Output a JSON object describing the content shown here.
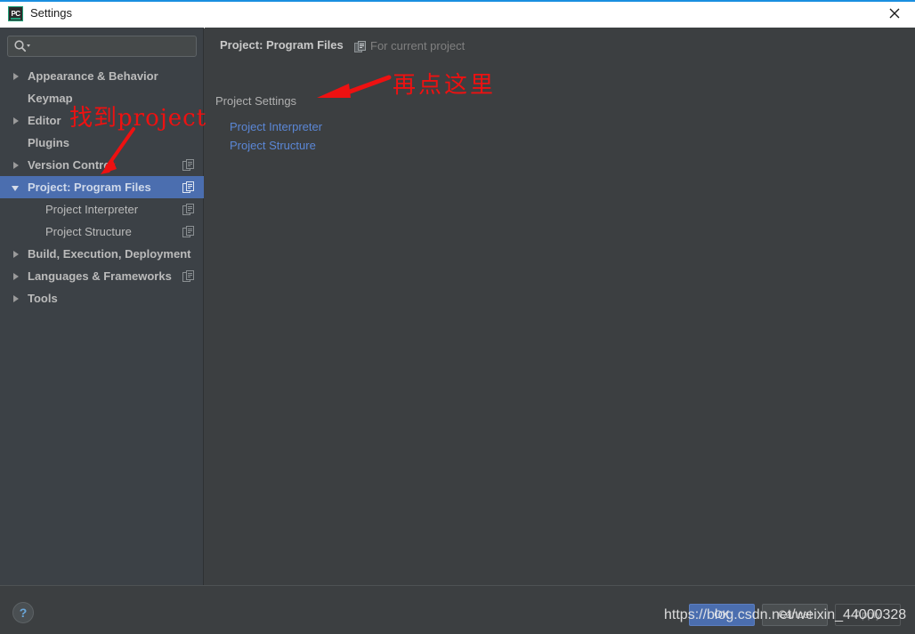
{
  "window": {
    "title": "Settings",
    "app_icon": "pycharm-icon",
    "app_icon_text": "PC",
    "close_icon": "close-icon"
  },
  "sidebar": {
    "search": {
      "placeholder": "",
      "value": "",
      "icon": "search-icon"
    },
    "items": [
      {
        "label": "Appearance & Behavior",
        "level": 0,
        "arrow": "right",
        "selected": false,
        "copy_icon": false
      },
      {
        "label": "Keymap",
        "level": 0,
        "arrow": "none",
        "selected": false,
        "copy_icon": false
      },
      {
        "label": "Editor",
        "level": 0,
        "arrow": "right",
        "selected": false,
        "copy_icon": false
      },
      {
        "label": "Plugins",
        "level": 0,
        "arrow": "none",
        "selected": false,
        "copy_icon": false
      },
      {
        "label": "Version Control",
        "level": 0,
        "arrow": "right",
        "selected": false,
        "copy_icon": true
      },
      {
        "label": "Project: Program Files",
        "level": 0,
        "arrow": "down",
        "selected": true,
        "copy_icon": true
      },
      {
        "label": "Project Interpreter",
        "level": 1,
        "arrow": "none",
        "selected": false,
        "copy_icon": true
      },
      {
        "label": "Project Structure",
        "level": 1,
        "arrow": "none",
        "selected": false,
        "copy_icon": true
      },
      {
        "label": "Build, Execution, Deployment",
        "level": 0,
        "arrow": "right",
        "selected": false,
        "copy_icon": false
      },
      {
        "label": "Languages & Frameworks",
        "level": 0,
        "arrow": "right",
        "selected": false,
        "copy_icon": true
      },
      {
        "label": "Tools",
        "level": 0,
        "arrow": "right",
        "selected": false,
        "copy_icon": false
      }
    ]
  },
  "main": {
    "panel_title": "Project: Program Files",
    "scope_label": "For current project",
    "scope_icon": "copy-scope-icon",
    "section_title": "Project Settings",
    "links": [
      {
        "label": "Project Interpreter"
      },
      {
        "label": "Project Structure"
      }
    ]
  },
  "bottom": {
    "help_icon": "question-mark-icon",
    "help_label": "?",
    "ok_label": "OK",
    "cancel_label": "Cancel",
    "apply_label": "Apply"
  },
  "annotations": [
    {
      "text": "找到project",
      "color": "#ee1111"
    },
    {
      "text": "再点这里",
      "color": "#ee1111"
    }
  ],
  "watermark": {
    "text": "https://blog.csdn.net/weixin_44000328"
  },
  "colors": {
    "accent_blue": "#1a8fe0",
    "selection_blue": "#4b6eaf",
    "link_blue": "#5b87d6",
    "sidebar_bg": "#3c4146",
    "panel_bg": "#3c3f41",
    "annotation_red": "#ee1111",
    "help_blue": "#6aa6d8"
  }
}
